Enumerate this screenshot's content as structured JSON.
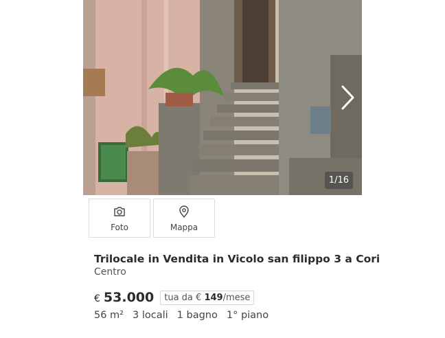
{
  "gallery": {
    "counter": "1/16",
    "next_icon": "chevron-right-icon"
  },
  "tabs": [
    {
      "label": "Foto",
      "icon": "camera-icon"
    },
    {
      "label": "Mappa",
      "icon": "map-pin-icon"
    }
  ],
  "listing": {
    "title": "Trilocale in Vendita in Vicolo san filippo 3 a Cori",
    "zone": "Centro",
    "currency": "€",
    "price": "53.000",
    "mortgage_prefix": "tua da € ",
    "mortgage_amount": "149",
    "mortgage_suffix": "/mese",
    "features": {
      "area": "56 m²",
      "rooms": "3 locali",
      "baths": "1 bagno",
      "floor": "1° piano"
    }
  }
}
